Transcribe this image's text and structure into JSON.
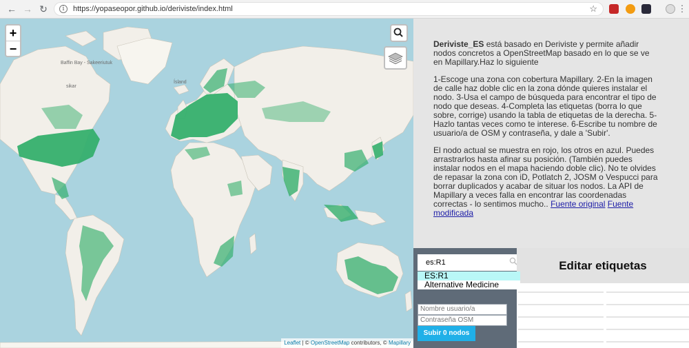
{
  "browser": {
    "url": "https://yopaseopor.github.io/deriviste/index.html",
    "back_icon": "arrow-left",
    "forward_icon": "arrow-right",
    "reload_icon": "reload",
    "star_icon": "star"
  },
  "map": {
    "zoom_in": "+",
    "zoom_out": "−",
    "labels": {
      "baffin_bay": "Baffin Bay - Sakeeriutuk",
      "sikar": "sikar",
      "iceland": "Ísland"
    },
    "attribution": {
      "leaflet": "Leaflet",
      "separator": " | © ",
      "osm": "OpenStreetMap",
      "contributors": " contributors, © ",
      "mapillary": "Mapillary"
    },
    "colors": {
      "water": "#aad3df",
      "land": "#f2efe9",
      "coverage": "#35af6d"
    }
  },
  "info": {
    "intro_brand": "Deriviste_ES",
    "intro_rest": " está basado en Deriviste y permite añadir nodos concretos a OpenStreetMap basado en lo que se ve en Mapillary.Haz lo siguiente",
    "steps": "1-Escoge una zona con cobertura Mapillary. 2-En la imagen de calle haz doble clic en la zona dónde quieres instalar el nodo. 3-Usa el campo de búsqueda para encontrar el tipo de nodo que deseas. 4-Completa las etiquetas (borra lo que sobre, corrige) usando la tabla de etiquetas de la derecha. 5-Hazlo tantas veces como te interese. 6-Escribe tu nombre de usuario/a de OSM y contraseña, y dale a 'Subir'.",
    "notes": "El nodo actual se muestra en rojo, los otros en azul. Puedes arrastrarlos hasta afinar su posición. (También puedes instalar nodos en el mapa haciendo doble clic). No te olvides de repasar la zona con iD, Potlatch 2, JOSM o Vespucci para borrar duplicados y acabar de situar los nodos. La API de Mapillary a veces falla en encontrar las coordenadas correctas - lo sentimos mucho.. ",
    "link_original": "Fuente original",
    "link_modified": "Fuente modificada"
  },
  "form": {
    "search_value": "es:R1",
    "suggestions": [
      "ES:R1",
      "Alternative Medicine"
    ],
    "username_placeholder": "Nombre usuario/a",
    "password_placeholder": "Contraseña OSM",
    "submit_label": "Subir 0 nodos"
  },
  "tags": {
    "title": "Editar etiquetas"
  }
}
